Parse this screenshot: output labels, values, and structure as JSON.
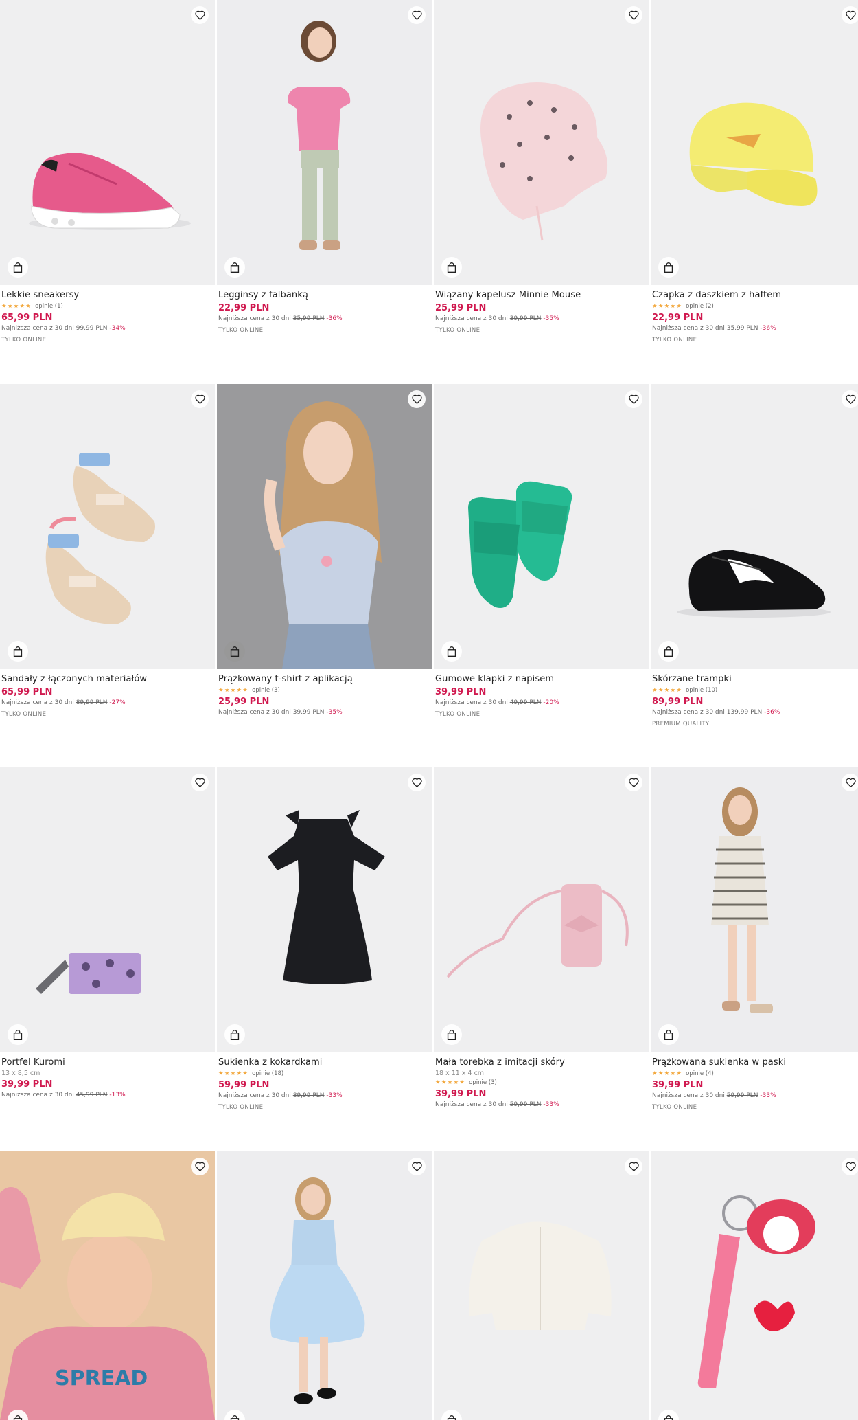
{
  "products": [
    {
      "name": "Lekkie sneakersy",
      "dim": "",
      "rating": {
        "stars": "★★★★★",
        "label": "opinie (1)"
      },
      "price": "65,99 PLN",
      "lowest_label": "Najniższa cena z 30 dni",
      "old_price": "99,99 PLN",
      "discount": "-34%",
      "tag": "TYLKO ONLINE",
      "image": "pink-sneaker"
    },
    {
      "name": "Legginsy z falbanką",
      "dim": "",
      "rating": null,
      "price": "22,99 PLN",
      "lowest_label": "Najniższa cena z 30 dni",
      "old_price": "35,99 PLN",
      "discount": "-36%",
      "tag": "TYLKO ONLINE",
      "image": "girl-pink-top"
    },
    {
      "name": "Wiązany kapelusz Minnie Mouse",
      "dim": "",
      "rating": null,
      "price": "25,99 PLN",
      "lowest_label": "Najniższa cena z 30 dni",
      "old_price": "39,99 PLN",
      "discount": "-35%",
      "tag": "TYLKO ONLINE",
      "image": "minnie-hat"
    },
    {
      "name": "Czapka z daszkiem z haftem",
      "dim": "",
      "rating": {
        "stars": "★★★★★",
        "label": "opinie (2)"
      },
      "price": "22,99 PLN",
      "lowest_label": "Najniższa cena z 30 dni",
      "old_price": "35,99 PLN",
      "discount": "-36%",
      "tag": "TYLKO ONLINE",
      "image": "yellow-cap"
    },
    {
      "name": "Sandały z łączonych materiałów",
      "dim": "",
      "rating": null,
      "price": "65,99 PLN",
      "lowest_label": "Najniższa cena z 30 dni",
      "old_price": "89,99 PLN",
      "discount": "-27%",
      "tag": "TYLKO ONLINE",
      "image": "sandals"
    },
    {
      "name": "Prążkowany t-shirt z aplikacją",
      "dim": "",
      "rating": {
        "stars": "★★★★★",
        "label": "opinie (3)"
      },
      "price": "25,99 PLN",
      "lowest_label": "Najniższa cena z 30 dni",
      "old_price": "39,99 PLN",
      "discount": "-35%",
      "tag": "",
      "image": "girl-blue-tshirt"
    },
    {
      "name": "Gumowe klapki z napisem",
      "dim": "",
      "rating": null,
      "price": "39,99 PLN",
      "lowest_label": "Najniższa cena z 30 dni",
      "old_price": "49,99 PLN",
      "discount": "-20%",
      "tag": "TYLKO ONLINE",
      "image": "green-slides"
    },
    {
      "name": "Skórzane trampki",
      "dim": "",
      "rating": {
        "stars": "★★★★★",
        "label": "opinie (10)"
      },
      "price": "89,99 PLN",
      "lowest_label": "Najniższa cena z 30 dni",
      "old_price": "139,99 PLN",
      "discount": "-36%",
      "tag": "PREMIUM QUALITY",
      "image": "black-sneaker"
    },
    {
      "name": "Portfel Kuromi",
      "dim": "13 x 8,5 cm",
      "rating": null,
      "price": "39,99 PLN",
      "lowest_label": "Najniższa cena z 30 dni",
      "old_price": "45,99 PLN",
      "discount": "-13%",
      "tag": "",
      "image": "kuromi-wallet"
    },
    {
      "name": "Sukienka z kokardkami",
      "dim": "",
      "rating": {
        "stars": "★★★★★",
        "label": "opinie (18)"
      },
      "price": "59,99 PLN",
      "lowest_label": "Najniższa cena z 30 dni",
      "old_price": "89,99 PLN",
      "discount": "-33%",
      "tag": "TYLKO ONLINE",
      "image": "black-dress"
    },
    {
      "name": "Mała torebka z imitacji skóry",
      "dim": "18 x 11 x 4 cm",
      "rating": {
        "stars": "★★★★★",
        "label": "opinie (3)"
      },
      "price": "39,99 PLN",
      "lowest_label": "Najniższa cena z 30 dni",
      "old_price": "59,99 PLN",
      "discount": "-33%",
      "tag": "",
      "image": "pink-bag"
    },
    {
      "name": "Prążkowana sukienka w paski",
      "dim": "",
      "rating": {
        "stars": "★★★★★",
        "label": "opinie (4)"
      },
      "price": "39,99 PLN",
      "lowest_label": "Najniższa cena z 30 dni",
      "old_price": "59,99 PLN",
      "discount": "-33%",
      "tag": "TYLKO ONLINE",
      "image": "girl-striped-dress"
    },
    {
      "name": "",
      "image": "girl-cap-sweatshirt"
    },
    {
      "name": "",
      "image": "girl-tulle-skirt"
    },
    {
      "name": "",
      "image": "white-cardigan"
    },
    {
      "name": "",
      "image": "my-melody-keychain"
    }
  ],
  "icons": {
    "favorite": "heart-icon",
    "add_to_cart": "shopping-bag-icon"
  },
  "colors": {
    "price": "#d0194f",
    "stars": "#f2a73b"
  }
}
